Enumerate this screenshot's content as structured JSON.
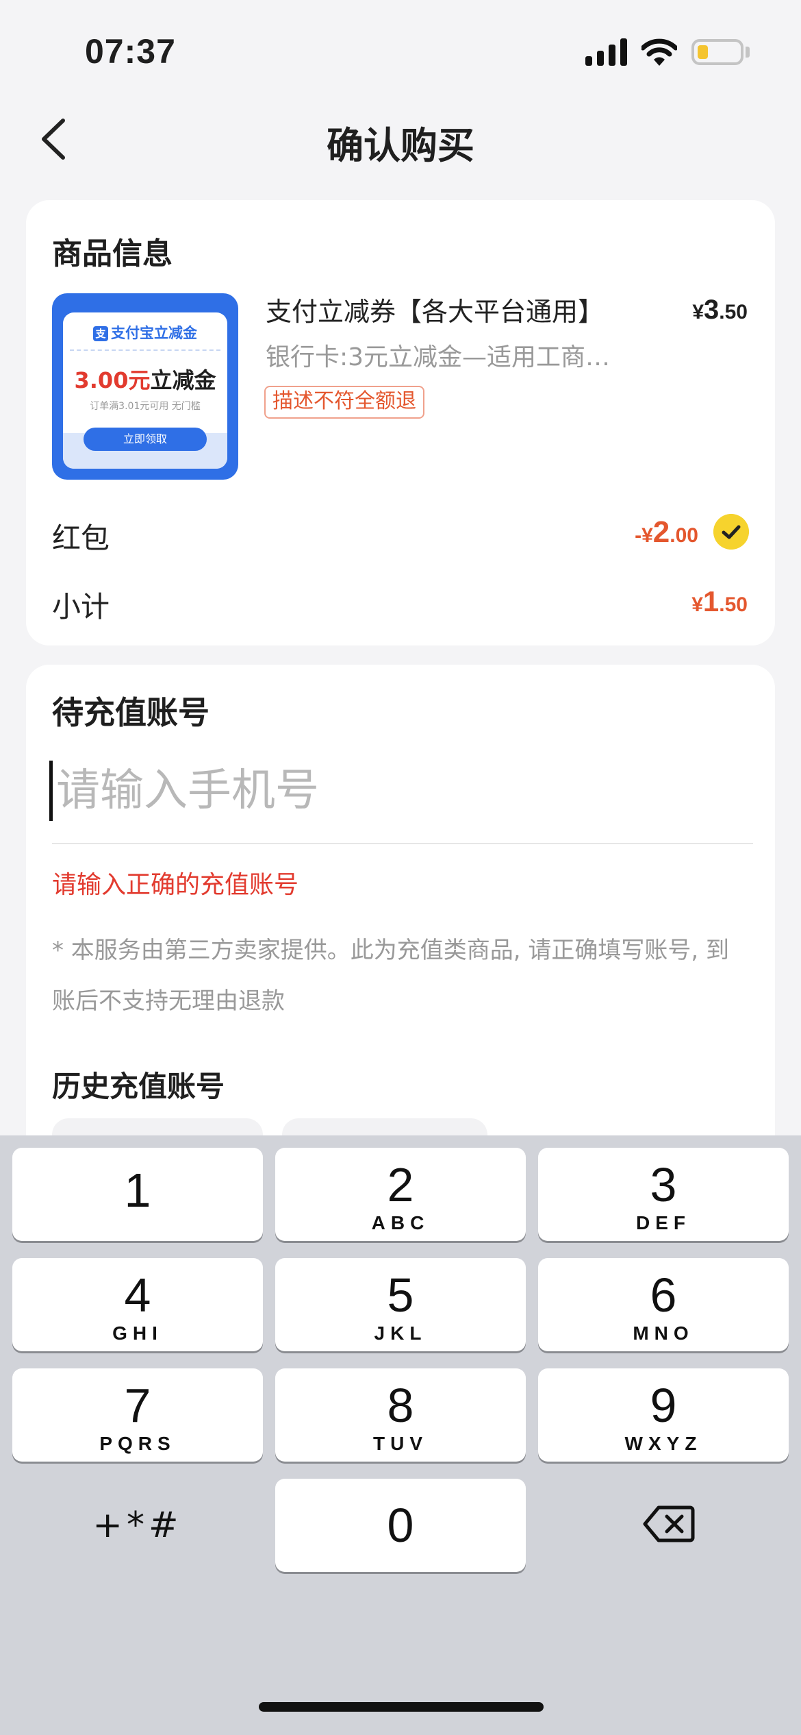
{
  "status_bar": {
    "time": "07:37"
  },
  "nav": {
    "title": "确认购买",
    "back_icon": "chevron-left-icon"
  },
  "product_card": {
    "section_title": "商品信息",
    "thumbnail": {
      "header": "支付宝立减金",
      "logo_glyph": "支",
      "amount": "3.00元",
      "amount_suffix": "立减金",
      "condition": "订单满3.01元可用 无门槛",
      "button": "立即领取"
    },
    "title": "支付立减券【各大平台通用】",
    "description": "银行卡:3元立减金—适用工商…",
    "tag": "描述不符全额退",
    "price_symbol": "¥",
    "price_int": "3",
    "price_dec": ".50",
    "red_packet": {
      "label": "红包",
      "prefix": "-¥",
      "int": "2",
      "dec": ".00",
      "checked": true
    },
    "subtotal": {
      "label": "小计",
      "prefix": "¥",
      "int": "1",
      "dec": ".50"
    }
  },
  "account_card": {
    "section_title": "待充值账号",
    "input": {
      "placeholder": "请输入手机号",
      "value": ""
    },
    "error": "请输入正确的充值账号",
    "note": "* 本服务由第三方卖家提供。此为充值类商品, 请正确填写账号, 到账后不支持无理由退款",
    "history_title": "历史充值账号"
  },
  "keyboard": {
    "keys": [
      {
        "num": "1",
        "letters": ""
      },
      {
        "num": "2",
        "letters": "ABC"
      },
      {
        "num": "3",
        "letters": "DEF"
      },
      {
        "num": "4",
        "letters": "GHI"
      },
      {
        "num": "5",
        "letters": "JKL"
      },
      {
        "num": "6",
        "letters": "MNO"
      },
      {
        "num": "7",
        "letters": "PQRS"
      },
      {
        "num": "8",
        "letters": "TUV"
      },
      {
        "num": "9",
        "letters": "WXYZ"
      }
    ],
    "symbols": "+*#",
    "zero": "0"
  },
  "colors": {
    "accent": "#e4572e",
    "error": "#e23b2f",
    "brand_blue": "#2f6fe6",
    "check_yellow": "#f6d32d"
  }
}
